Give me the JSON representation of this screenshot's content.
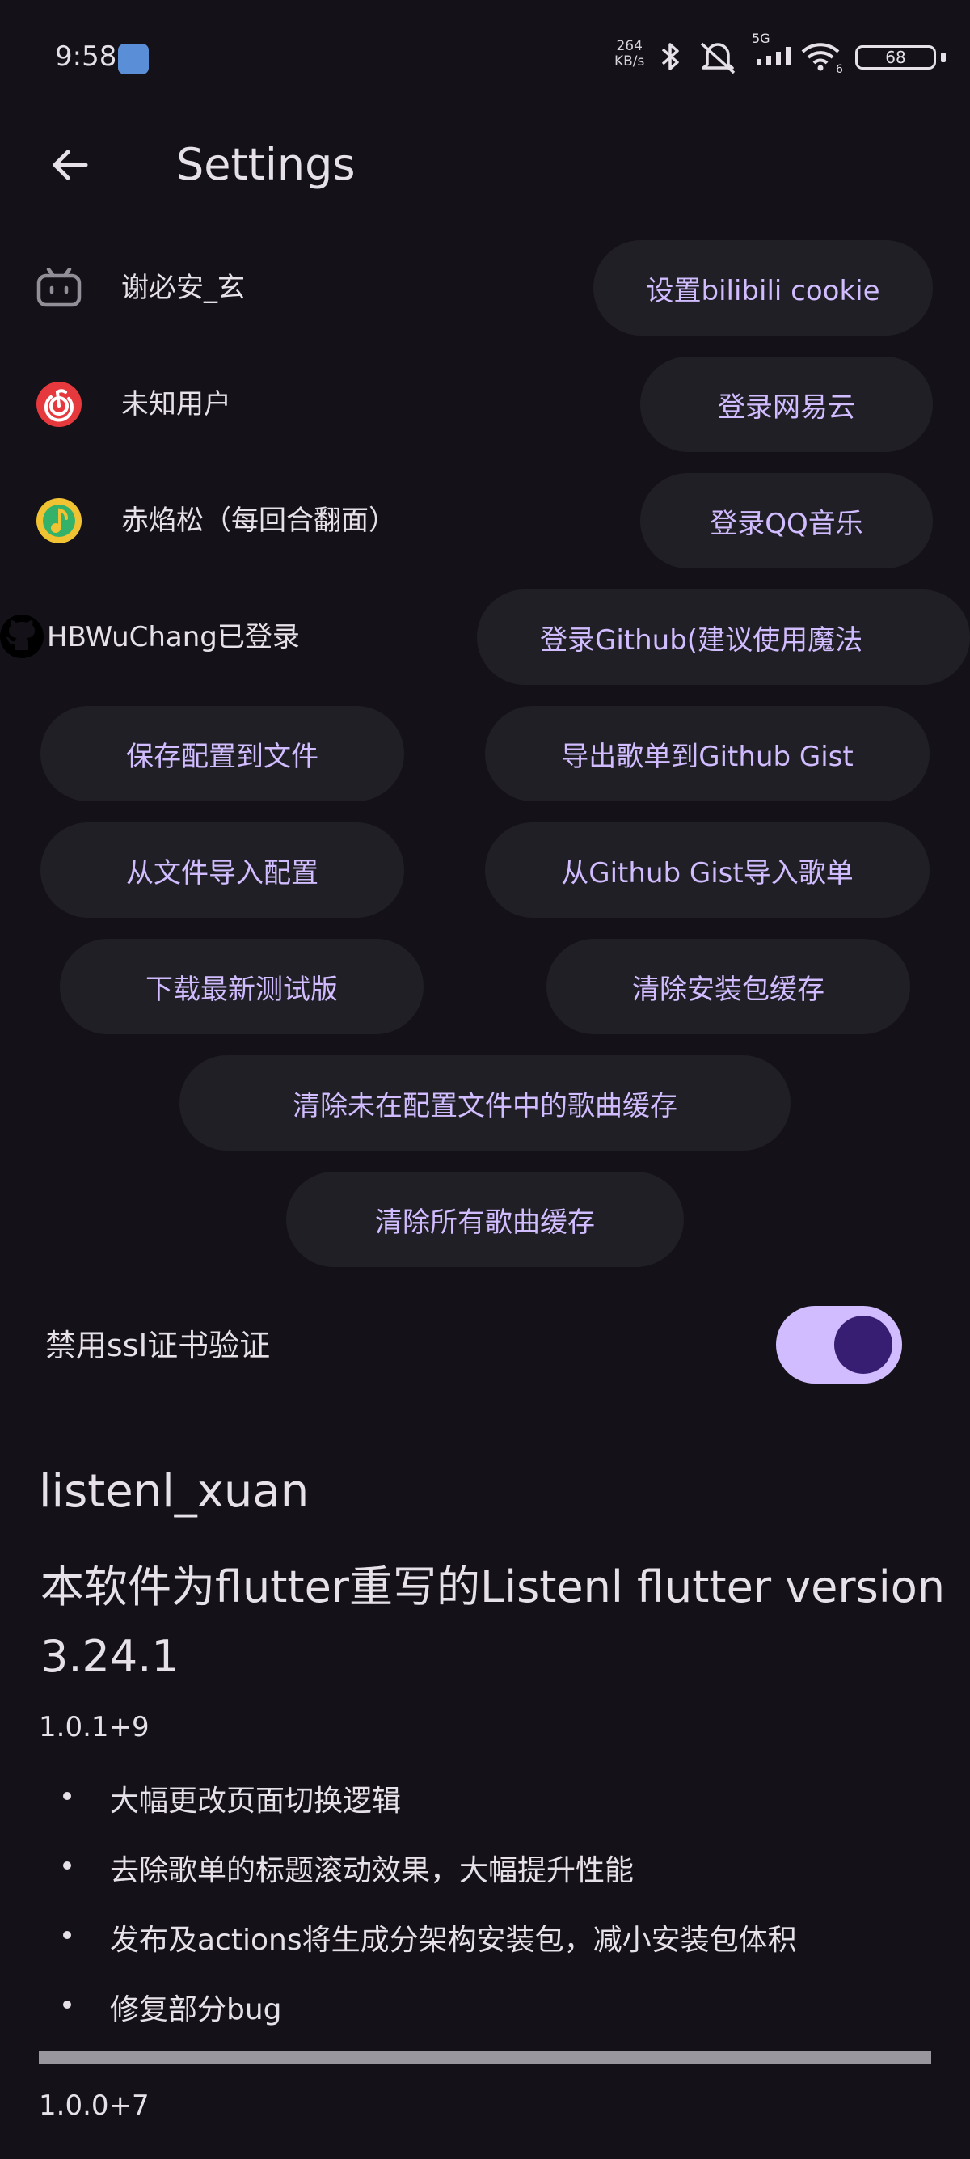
{
  "status_bar": {
    "time": "9:58",
    "net_speed_value": "264",
    "net_speed_unit": "KB/s",
    "network_type": "5G",
    "wifi_suffix": "6",
    "battery": "68",
    "icons": [
      "app-badge-icon",
      "bluetooth-icon",
      "alarm-off-icon",
      "signal-icon",
      "wifi-icon",
      "battery-icon"
    ]
  },
  "app_bar": {
    "title": "Settings",
    "back_icon": "arrow-back-icon"
  },
  "accounts": [
    {
      "icon": "bilibili-icon",
      "name": "谢必安_玄",
      "button": "设置bilibili cookie"
    },
    {
      "icon": "netease-icon",
      "name": "未知用户",
      "button": "登录网易云"
    },
    {
      "icon": "qqmusic-icon",
      "name": "赤焰松（每回合翻面）",
      "button": "登录QQ音乐"
    },
    {
      "icon": "github-icon",
      "name": "HBWuChang已登录",
      "button": "登录Github(建议使用魔法"
    }
  ],
  "actions": {
    "save_config": "保存配置到文件",
    "export_gist": "导出歌单到Github Gist",
    "import_config": "从文件导入配置",
    "import_gist": "从Github Gist导入歌单",
    "download_beta": "下载最新测试版",
    "clear_apk_cache": "清除安装包缓存",
    "clear_orphan_cache": "清除未在配置文件中的歌曲缓存",
    "clear_all_cache": "清除所有歌曲缓存"
  },
  "ssl_toggle": {
    "label": "禁用ssl证书验证",
    "enabled": true
  },
  "about": {
    "app_name": "listenl_xuan",
    "description": "本软件为flutter重写的Listenl flutter version 3.24.1",
    "changelog": [
      {
        "version": "1.0.1+9",
        "items": [
          "大幅更改页面切换逻辑",
          "去除歌单的标题滚动效果，大幅提升性能",
          "发布及actions将生成分架构安装包，减小安装包体积",
          "修复部分bug"
        ]
      },
      {
        "version": "1.0.0+7",
        "items": []
      }
    ]
  },
  "colors": {
    "background": "#141218",
    "surface_button": "#211f26",
    "accent_text": "#d0bcff",
    "toggle_track": "#d0bcff",
    "toggle_thumb": "#381e72",
    "divider": "#9a969e"
  }
}
